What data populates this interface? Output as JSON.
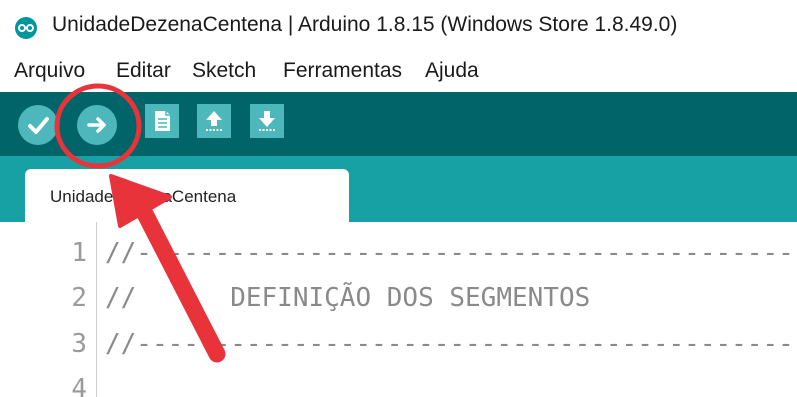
{
  "window": {
    "title": "UnidadeDezenaCentena | Arduino 1.8.15 (Windows Store 1.8.49.0)",
    "icon": "arduino-logo-icon"
  },
  "menu": [
    {
      "label": "Arquivo"
    },
    {
      "label": "Editar"
    },
    {
      "label": "Sketch"
    },
    {
      "label": "Ferramentas"
    },
    {
      "label": "Ajuda"
    }
  ],
  "toolbar": {
    "buttons": [
      {
        "icon": "verify-check-icon"
      },
      {
        "icon": "upload-arrow-icon"
      },
      {
        "icon": "new-file-icon"
      },
      {
        "icon": "open-upload-icon"
      },
      {
        "icon": "save-download-icon"
      }
    ]
  },
  "tabs": [
    {
      "label": "UnidadeDezenaCentena"
    }
  ],
  "editor": {
    "lines": [
      {
        "number": "1",
        "code": "//-------------------------------------------------"
      },
      {
        "number": "2",
        "code": "//      DEFINIÇÃO DOS SEGMENTOS"
      },
      {
        "number": "3",
        "code": "//-------------------------------------------------"
      },
      {
        "number": "4",
        "code": ""
      }
    ]
  },
  "annotation": {
    "color": "#e8333a"
  },
  "colors": {
    "toolbar": "#006468",
    "tabbar": "#17a1a5",
    "button": "#4db7bb"
  }
}
